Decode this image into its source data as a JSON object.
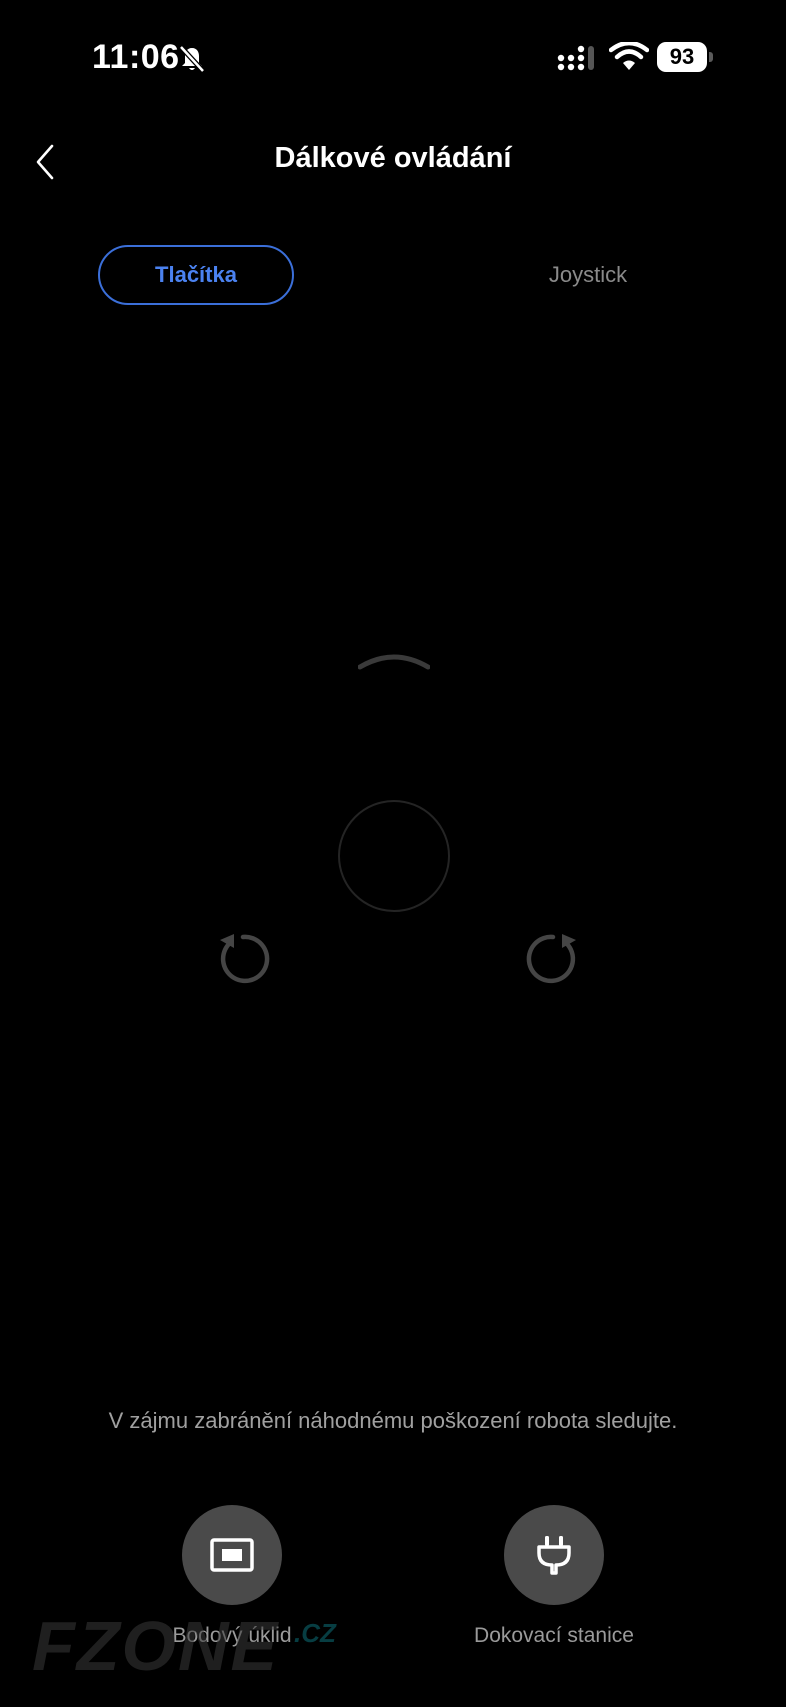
{
  "status_bar": {
    "time": "11:06",
    "battery": "93",
    "icons": [
      "bell-muted-icon",
      "cellular-signal-icon",
      "wifi-icon",
      "battery-icon"
    ]
  },
  "header": {
    "title": "Dálkové ovládání",
    "back_icon": "chevron-left-icon"
  },
  "tabs": [
    {
      "label": "Tlačítka",
      "active": true
    },
    {
      "label": "Joystick",
      "active": false
    }
  ],
  "controls": {
    "icons": [
      "arrow-up-icon",
      "center-stop-ring",
      "rotate-left-icon",
      "rotate-right-icon"
    ]
  },
  "hint": "V zájmu zabránění náhodnému poškození robota sledujte.",
  "actions": [
    {
      "label": "Bodový úklid",
      "icon": "spot-clean-icon"
    },
    {
      "label": "Dokovací stanice",
      "icon": "plug-icon"
    }
  ],
  "colors": {
    "background": "#000000",
    "accent": "#4b82f0",
    "action_button": "#4a4a4a"
  },
  "watermark": {
    "text": "FZONE",
    "suffix": ".CZ"
  }
}
